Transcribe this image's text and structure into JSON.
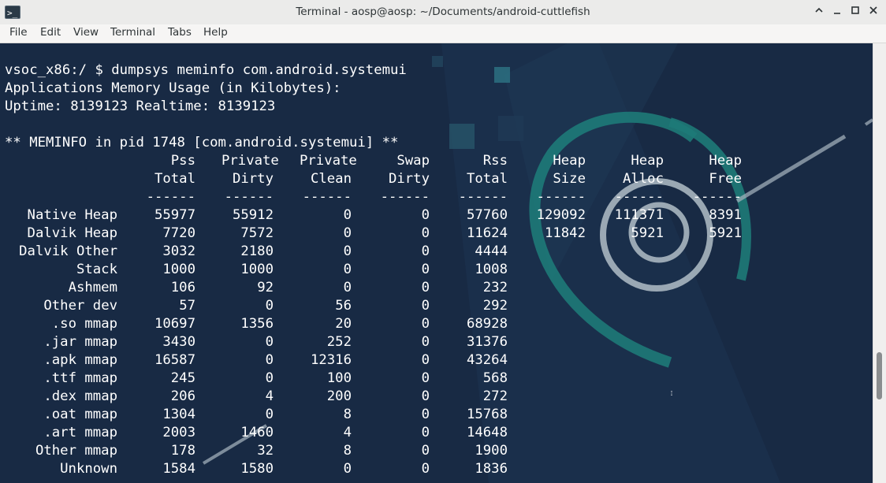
{
  "window": {
    "title": "Terminal - aosp@aosp: ~/Documents/android-cuttlefish",
    "app_icon_glyph": ">_"
  },
  "menu": [
    "File",
    "Edit",
    "View",
    "Terminal",
    "Tabs",
    "Help"
  ],
  "colors": {
    "terminal_bg": "#182a44",
    "terminal_fg": "#ffffff",
    "wallpaper_accent": "#1e7a78",
    "swirl": "#a9b6c0"
  },
  "terminal": {
    "prompt_line": "vsoc_x86:/ $ dumpsys meminfo com.android.systemui",
    "line2": "Applications Memory Usage (in Kilobytes):",
    "line3": "Uptime: 8139123 Realtime: 8139123",
    "line5": "** MEMINFO in pid 1748 [com.android.systemui] **",
    "header_row1": [
      "Pss",
      "Private",
      "Private",
      "Swap",
      "Rss",
      "Heap",
      "Heap",
      "Heap"
    ],
    "header_row2": [
      "Total",
      "Dirty",
      "Clean",
      "Dirty",
      "Total",
      "Size",
      "Alloc",
      "Free"
    ],
    "separator": "------",
    "rows": [
      {
        "label": "Native Heap",
        "cells": [
          "55977",
          "55912",
          "0",
          "0",
          "57760",
          "129092",
          "111371",
          "8391"
        ]
      },
      {
        "label": "Dalvik Heap",
        "cells": [
          "7720",
          "7572",
          "0",
          "0",
          "11624",
          "11842",
          "5921",
          "5921"
        ]
      },
      {
        "label": "Dalvik Other",
        "cells": [
          "3032",
          "2180",
          "0",
          "0",
          "4444",
          "",
          "",
          ""
        ]
      },
      {
        "label": "Stack",
        "cells": [
          "1000",
          "1000",
          "0",
          "0",
          "1008",
          "",
          "",
          ""
        ]
      },
      {
        "label": "Ashmem",
        "cells": [
          "106",
          "92",
          "0",
          "0",
          "232",
          "",
          "",
          ""
        ]
      },
      {
        "label": "Other dev",
        "cells": [
          "57",
          "0",
          "56",
          "0",
          "292",
          "",
          "",
          ""
        ]
      },
      {
        "label": ".so mmap",
        "cells": [
          "10697",
          "1356",
          "20",
          "0",
          "68928",
          "",
          "",
          ""
        ]
      },
      {
        "label": ".jar mmap",
        "cells": [
          "3430",
          "0",
          "252",
          "0",
          "31376",
          "",
          "",
          ""
        ]
      },
      {
        "label": ".apk mmap",
        "cells": [
          "16587",
          "0",
          "12316",
          "0",
          "43264",
          "",
          "",
          ""
        ]
      },
      {
        "label": ".ttf mmap",
        "cells": [
          "245",
          "0",
          "100",
          "0",
          "568",
          "",
          "",
          ""
        ]
      },
      {
        "label": ".dex mmap",
        "cells": [
          "206",
          "4",
          "200",
          "0",
          "272",
          "",
          "",
          ""
        ]
      },
      {
        "label": ".oat mmap",
        "cells": [
          "1304",
          "0",
          "8",
          "0",
          "15768",
          "",
          "",
          ""
        ]
      },
      {
        "label": ".art mmap",
        "cells": [
          "2003",
          "1460",
          "4",
          "0",
          "14648",
          "",
          "",
          ""
        ]
      },
      {
        "label": "Other mmap",
        "cells": [
          "178",
          "32",
          "8",
          "0",
          "1900",
          "",
          "",
          ""
        ]
      },
      {
        "label": "Unknown",
        "cells": [
          "1584",
          "1580",
          "0",
          "0",
          "1836",
          "",
          "",
          ""
        ]
      }
    ]
  }
}
